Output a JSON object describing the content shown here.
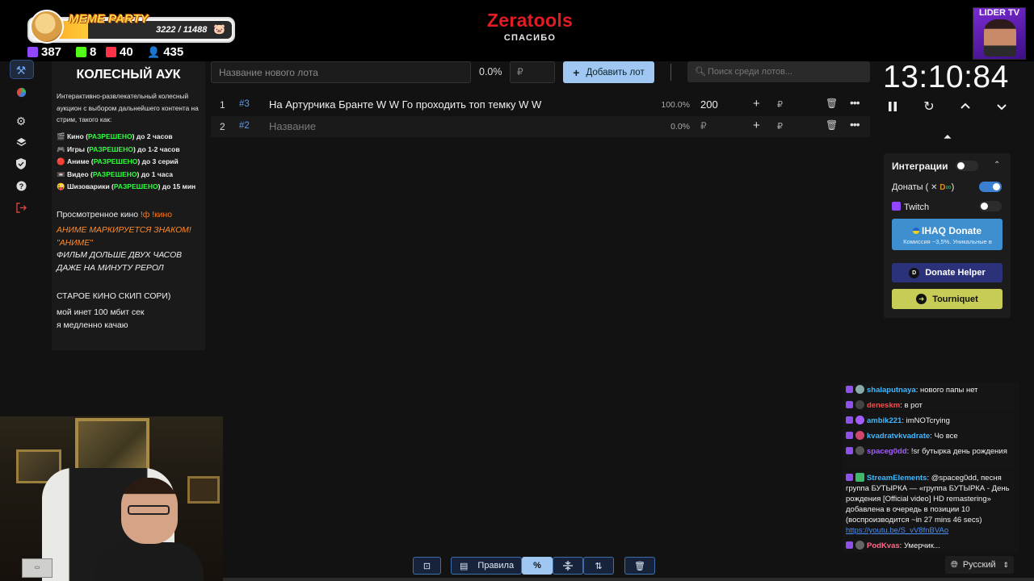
{
  "overlay": {
    "meme_title": "MEME PARTY",
    "meme_count": "3222 / 11488",
    "meme_progress": 0.28,
    "stats": [
      {
        "icon": "twitch-icon",
        "value": "387",
        "color": "#9146ff"
      },
      {
        "icon": "kick-icon",
        "value": "8",
        "color": "#53fc18"
      },
      {
        "icon": "vk-live-icon",
        "value": "40",
        "color": "#ff3347"
      },
      {
        "icon": "viewers-icon",
        "value": "435",
        "color": "#6ab0ff"
      }
    ],
    "brand": "Zeratools",
    "brand_sub": "СПАСИБО",
    "channel_name": "LIDER TV"
  },
  "sidebar": {
    "items": [
      {
        "icon": "auction-hammer-icon",
        "active": true
      },
      {
        "icon": "wheel-icon"
      },
      {
        "icon": "gear-icon"
      },
      {
        "icon": "layers-icon"
      },
      {
        "icon": "shield-icon"
      },
      {
        "icon": "help-icon"
      },
      {
        "icon": "logout-icon"
      }
    ]
  },
  "rules": {
    "title": "КОЛЕСНЫЙ АУК",
    "intro": "Интерактивно-развлекательный колесный аукцион с выбором дальнейшего контента на стрим, такого как:",
    "lines": [
      {
        "emoji": "🎬",
        "name": "Кино",
        "status": "РАЗРЕШЕНО",
        "limit": "до 2 часов"
      },
      {
        "emoji": "🎮",
        "name": "Игры",
        "status": "РАЗРЕШЕНО",
        "limit": "до 1-2 часов"
      },
      {
        "emoji": "🔴",
        "name": "Аниме",
        "status": "РАЗРЕШЕНО",
        "limit": "до 3 серий"
      },
      {
        "emoji": "📼",
        "name": "Видео",
        "status": "РАЗРЕШЕНО",
        "limit": "до 1 часа"
      },
      {
        "emoji": "😜",
        "name": "Шизоварики",
        "status": "РАЗРЕШЕНО",
        "limit": "до 15 мин"
      }
    ],
    "watched_label": "Просмотренное кино",
    "watched_cmd": "!ф !кино",
    "note1": "АНИМЕ МАРКИРУЕТСЯ ЗНАКОМ!",
    "note2": "\"АНИМЕ\"",
    "note3": "ФИЛЬМ ДОЛЬШЕ ДВУХ ЧАСОВ",
    "note4": "ДАЖЕ НА МИНУТУ РЕРОЛ",
    "note5": "СТАРОЕ КИНО СКИП СОРИ)",
    "note6": "мой инет 100 мбит сек",
    "note7": "я медленно качаю"
  },
  "toolbar": {
    "lot_placeholder": "Название нового лота",
    "percent": "0.0%",
    "currency": "₽",
    "add_label": "Добавить лот",
    "search_placeholder": "Поиск среди лотов..."
  },
  "lots": [
    {
      "num": "1",
      "id": "#3",
      "name": "На Артурчика Бранте W W Го проходить топ темку W W",
      "pct": "100.0%",
      "amount": "200",
      "currency": "₽"
    },
    {
      "num": "2",
      "id": "#2",
      "name": "Название",
      "pct": "0.0%",
      "amount": "₽",
      "currency": "₽",
      "placeholder": true
    }
  ],
  "timer": {
    "value": "13:10:84"
  },
  "integrations": {
    "title": "Интеграции",
    "donations_label": "Донаты (",
    "donations_suffix": ")",
    "twitch_label": "Twitch",
    "ihaq_title": "IHAQ Donate",
    "ihaq_sub": "Комиссия ~3,5%. Уникальные в",
    "donate_helper": "Donate Helper",
    "tourniquet": "Tourniquet"
  },
  "chat": [
    {
      "user": "shalaputnaya",
      "color": "#3fb8ff",
      "text": "нового папы нет"
    },
    {
      "user": "deneskm",
      "color": "#ff4a4a",
      "text": "в рот"
    },
    {
      "user": "ambik221",
      "color": "#3fb8ff",
      "text": "imNOTcrying"
    },
    {
      "user": "kvadratvkvadrate",
      "color": "#3fb8ff",
      "text": "Чо все"
    },
    {
      "user": "spaceg0dd",
      "color": "#a45bff",
      "text": "!sr бутырка день рождения"
    },
    {
      "user": "StreamElements",
      "color": "#3fb8ff",
      "text": "@spaceg0dd, песня группа БУТЫРКА — «группа БУТЫРКА - День рождения [Official video] HD remastering» добавлена в очередь в позиции 10 (воспроизводится ~in 27 mins 46 secs)",
      "link": "https://youtu.be/S_vV8fnBVAo"
    },
    {
      "user": "PodKvas",
      "color": "#ff6b8a",
      "text": "Умерчик..."
    }
  ],
  "bottom": {
    "rules_label": "Правила",
    "language": "Русский"
  },
  "colors": {
    "accent": "#9fc7f2",
    "brand_red": "#e31b23",
    "allowed_green": "#2cff3b"
  }
}
